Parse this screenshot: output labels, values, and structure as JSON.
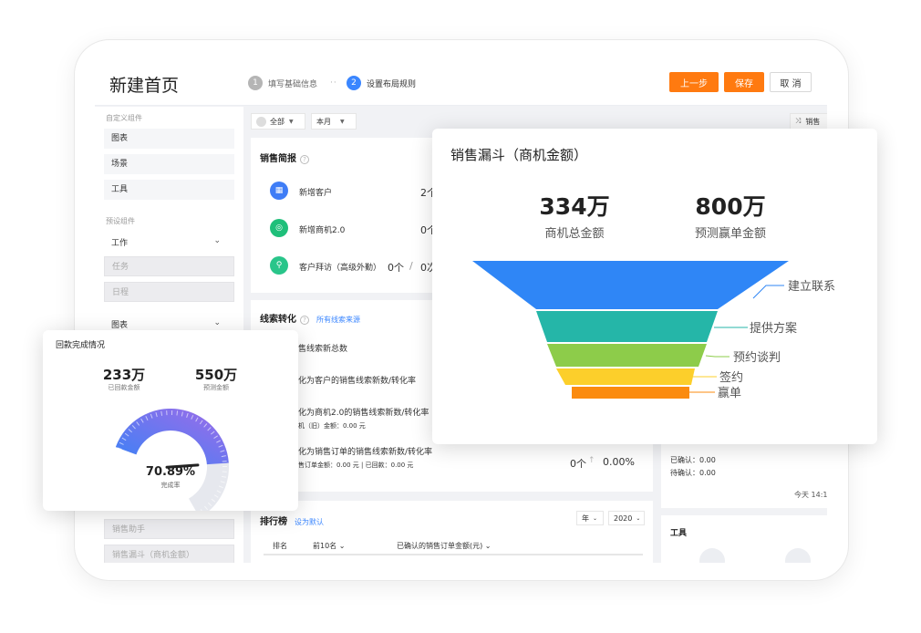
{
  "header": {
    "title": "新建首页",
    "step1_num": "1",
    "step1_label": "填写基础信息",
    "dots": "··",
    "step2_num": "2",
    "step2_label": "设置布局规则",
    "prev": "上一步",
    "save": "保存",
    "cancel": "取 消"
  },
  "sidebar": {
    "custom_label": "自定义组件",
    "custom_items": [
      "图表",
      "场景",
      "工具"
    ],
    "preset_label": "预设组件",
    "group1": "工作",
    "group1_items": [
      "任务",
      "日程"
    ],
    "group2": "图表",
    "bottom_items": [
      "销售助手",
      "销售漏斗（商机金额）"
    ]
  },
  "filters": {
    "scope": "全部",
    "period": "本月",
    "right_tag": "销售"
  },
  "sales_brief": {
    "title": "销售简报",
    "rows": [
      {
        "label": "新增客户",
        "value": "2个"
      },
      {
        "label": "新增商机2.0",
        "value": "0个"
      },
      {
        "label": "客户拜访（高级外勤）",
        "value": "0个",
        "sep": "/",
        "value2": "0次"
      }
    ]
  },
  "lead_conversion": {
    "title": "线索转化",
    "link": "所有线索来源",
    "rows": [
      {
        "label": "售线索新总数"
      },
      {
        "label": "化为客户的销售线索新数/转化率"
      },
      {
        "label": "化为商机2.0的销售线索新数/转化率",
        "sub": "机（旧）金额：0.00 元"
      },
      {
        "label": "化为销售订单的销售线索新数/转化率",
        "sub": "售订单金额：0.00 元  |  已回款：0.00 元",
        "value": "0个",
        "arrow": "↑",
        "rate": "0.00%"
      }
    ]
  },
  "right_panel": {
    "confirmed": "已确认：0.00",
    "pending": "待确认：0.00",
    "time": "今天 14:1",
    "tools_title": "工具"
  },
  "ranking": {
    "title": "排行榜",
    "link": "设为默认",
    "year_sel": "年",
    "year_val": "2020",
    "col_rank": "排名",
    "col_top": "前10名",
    "col_amount": "已确认的销售订单金额(元)"
  },
  "funnel_card": {
    "title": "销售漏斗（商机金额）",
    "total_value": "334万",
    "total_label": "商机总金额",
    "forecast_value": "800万",
    "forecast_label": "预测赢单金额",
    "stages": [
      {
        "name": "建立联系",
        "color": "#2f86f6"
      },
      {
        "name": "提供方案",
        "color": "#25b6a8"
      },
      {
        "name": "预约谈判",
        "color": "#8dcc4a"
      },
      {
        "name": "签约",
        "color": "#fccf2b"
      },
      {
        "name": "赢单",
        "color": "#fb8b0f"
      }
    ]
  },
  "payment_card": {
    "title": "回款完成情况",
    "received_value": "233万",
    "received_label": "已回款金额",
    "forecast_value": "550万",
    "forecast_label": "预测金额",
    "percent": "70.89%",
    "percent_label": "完成率",
    "fraction": 0.7089
  }
}
